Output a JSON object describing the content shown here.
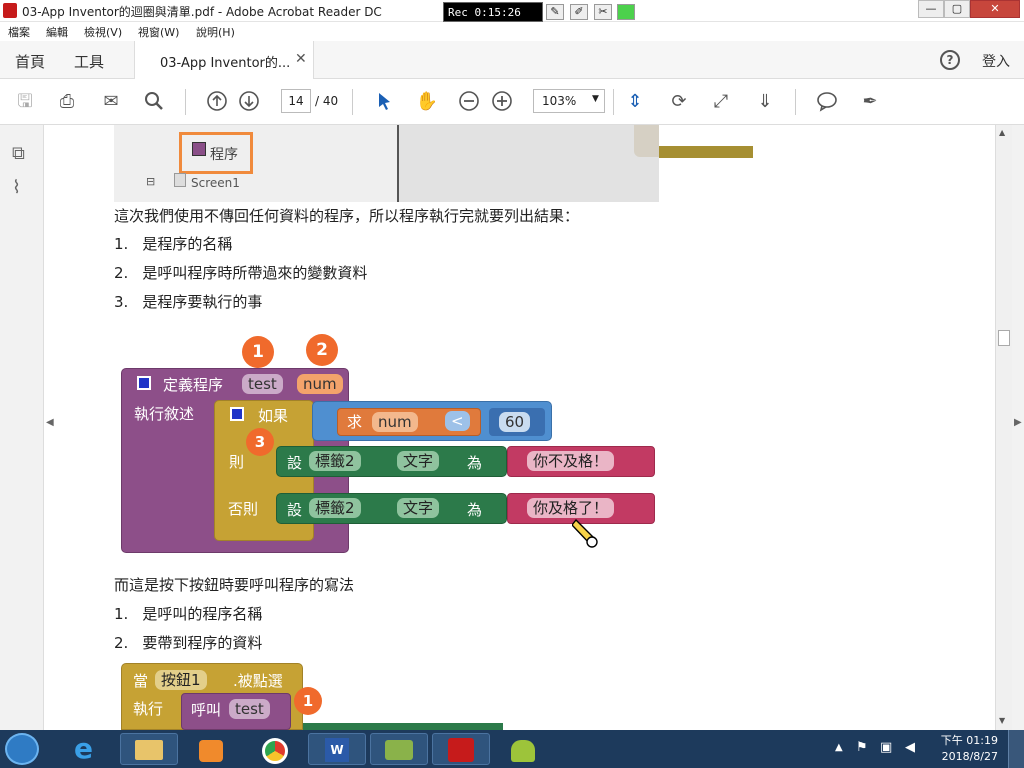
{
  "window": {
    "title": "03-App Inventor的迴圈與清單.pdf - Adobe Acrobat Reader DC",
    "min_glyph": "—",
    "max_glyph": "▢",
    "close_glyph": "✕"
  },
  "recorder": {
    "time": "Rec 0:15:26"
  },
  "menubar": {
    "items": [
      "檔案",
      "編輯",
      "檢視(V)",
      "視窗(W)",
      "說明(H)"
    ]
  },
  "tabs": {
    "home": "首頁",
    "tools": "工具",
    "document": "03-App Inventor的...",
    "close_glyph": "✕",
    "help_glyph": "?",
    "login": "登入"
  },
  "toolbar": {
    "page_current": "14",
    "page_total": "/ 40",
    "zoom": "103%"
  },
  "doc": {
    "screenshot_top": {
      "item1": "程序",
      "item2": "Screen1"
    },
    "para1": "這次我們使用不傳回任何資料的程序，所以程序執行完就要列出結果：",
    "list1": [
      {
        "num": "1.",
        "text": "是程序的名稱"
      },
      {
        "num": "2.",
        "text": "是呼叫程序時所帶過來的變數資料"
      },
      {
        "num": "3.",
        "text": "是程序要執行的事"
      }
    ],
    "blocks": {
      "define": "定義程序",
      "proc_name": "test",
      "param": "num",
      "do": "執行敘述",
      "if": "如果",
      "get": "求",
      "get_var": "num",
      "op": "<",
      "num_val": "60",
      "then": "則",
      "else": "否則",
      "set": "設",
      "comp": "標籤2",
      "prop": "文字",
      "to": "為",
      "str1": "你不及格！",
      "str2": "你及格了！",
      "badge1": "1",
      "badge2": "2",
      "badge3": "3"
    },
    "para2": "而這是按下按鈕時要呼叫程序的寫法",
    "list2": [
      {
        "num": "1.",
        "text": "是呼叫的程序名稱"
      },
      {
        "num": "2.",
        "text": "要帶到程序的資料"
      }
    ],
    "blocks2": {
      "when": "當",
      "button": "按鈕1",
      "event": ".被點選",
      "do": "執行",
      "call": "呼叫",
      "proc": "test",
      "badge": "1"
    }
  },
  "taskbar": {
    "time": "下午 01:19",
    "date": "2018/8/27"
  }
}
